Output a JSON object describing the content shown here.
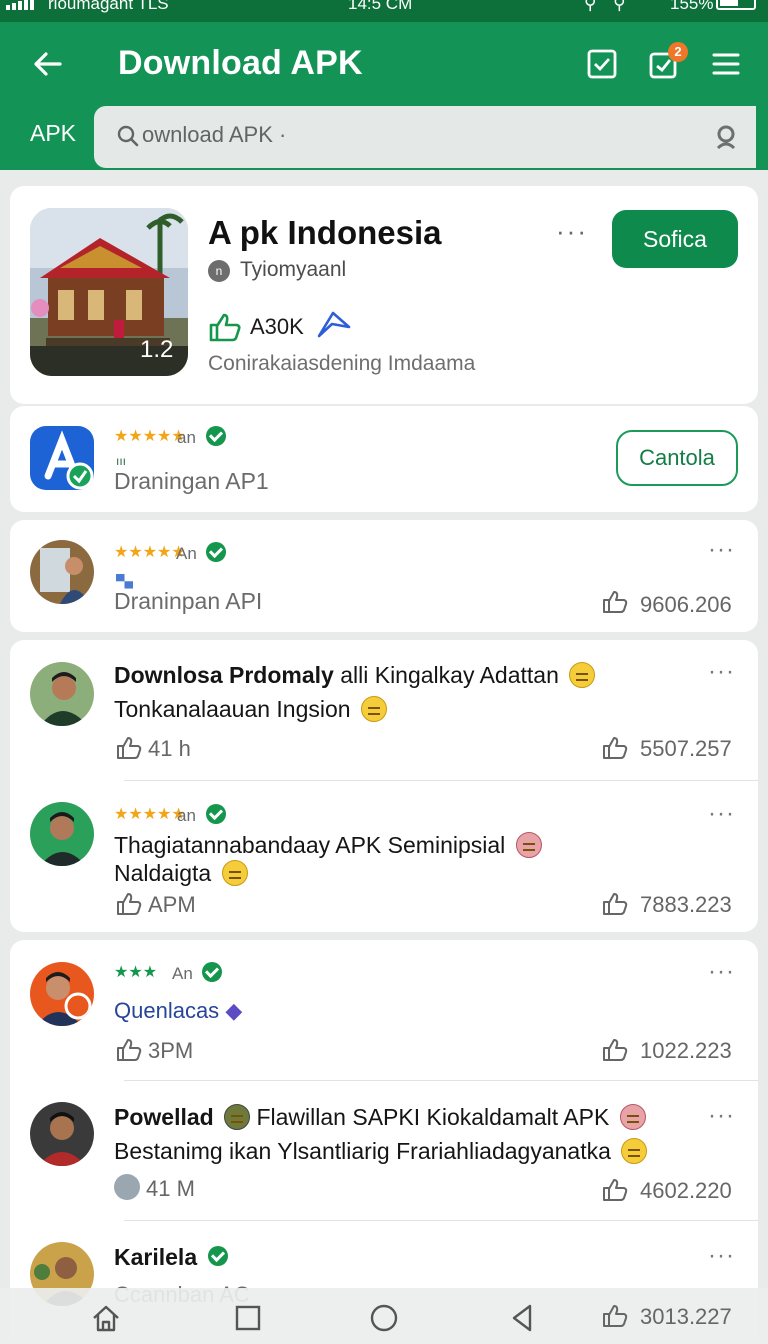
{
  "status_bar": {
    "carrier": "rioumagant  TLS",
    "time": "14:5 CM",
    "battery": "155%"
  },
  "app_bar": {
    "title": "Download APK",
    "notification_badge": "2",
    "tab_label": "APK"
  },
  "search": {
    "placeholder": "ownload APK ·"
  },
  "featured_app": {
    "name": "A pk Indonesia",
    "developer": "Tyiomyaanl",
    "developer_badge": "n",
    "likes": "A30K",
    "subtitle": "Conirakaiasdening Imdaama",
    "badge_text": "1.2",
    "action_label": "Sofica",
    "more_label": "···"
  },
  "app_items": [
    {
      "stars": "★★★★★",
      "meta": "an",
      "glyph": "ııı",
      "name": "Draningan AP1",
      "action_label": "Cantola"
    },
    {
      "stars": "★★★★★",
      "meta": "An",
      "glyph": "▀▄",
      "name": "Draninpan API",
      "count": "9606.206",
      "more_label": "···"
    }
  ],
  "posts": [
    {
      "author": "Downlosa Prdomaly",
      "line1": " alli Kingalkay Adattan",
      "line2": "Tonkanalaauan Ingsion",
      "likes": "41 h",
      "count": "5507.257",
      "more_label": "···"
    },
    {
      "stars": "★★★★★",
      "meta": "an",
      "line1": "Thagiatannabandaay APK Seminipsial",
      "line2": "Naldaigta",
      "likes": "APM",
      "count": "7883.223",
      "more_label": "···"
    },
    {
      "stars": "★★★",
      "meta": "An",
      "link": "Quenlacas",
      "likes": "3PM",
      "count": "1022.223",
      "more_label": "···"
    },
    {
      "author": "Powellad",
      "line1": " Flawillan SAPKI Kiokaldamalt APK",
      "line2": "Bestanimg ikan Ylsantliarig Frariahliadagyanatka",
      "likes": "41 M",
      "count": "4602.220",
      "more_label": "···"
    },
    {
      "author": "Karilela",
      "line2": "Ccannban AC",
      "count": "3013.227",
      "more_label": "···"
    }
  ],
  "colors": {
    "primary": "#139456",
    "primary_dark": "#0d6f3a",
    "button": "#0f8a4d",
    "star": "#f2a516",
    "verified": "#14964d",
    "badge": "#f0762a"
  },
  "icons": [
    "back-arrow-icon",
    "checkbox-icon",
    "notification-icon",
    "menu-icon",
    "search-icon",
    "voice-icon",
    "like-icon",
    "send-icon",
    "verified-icon",
    "home-icon",
    "recents-icon",
    "circle-home-icon",
    "back-triangle-icon"
  ]
}
